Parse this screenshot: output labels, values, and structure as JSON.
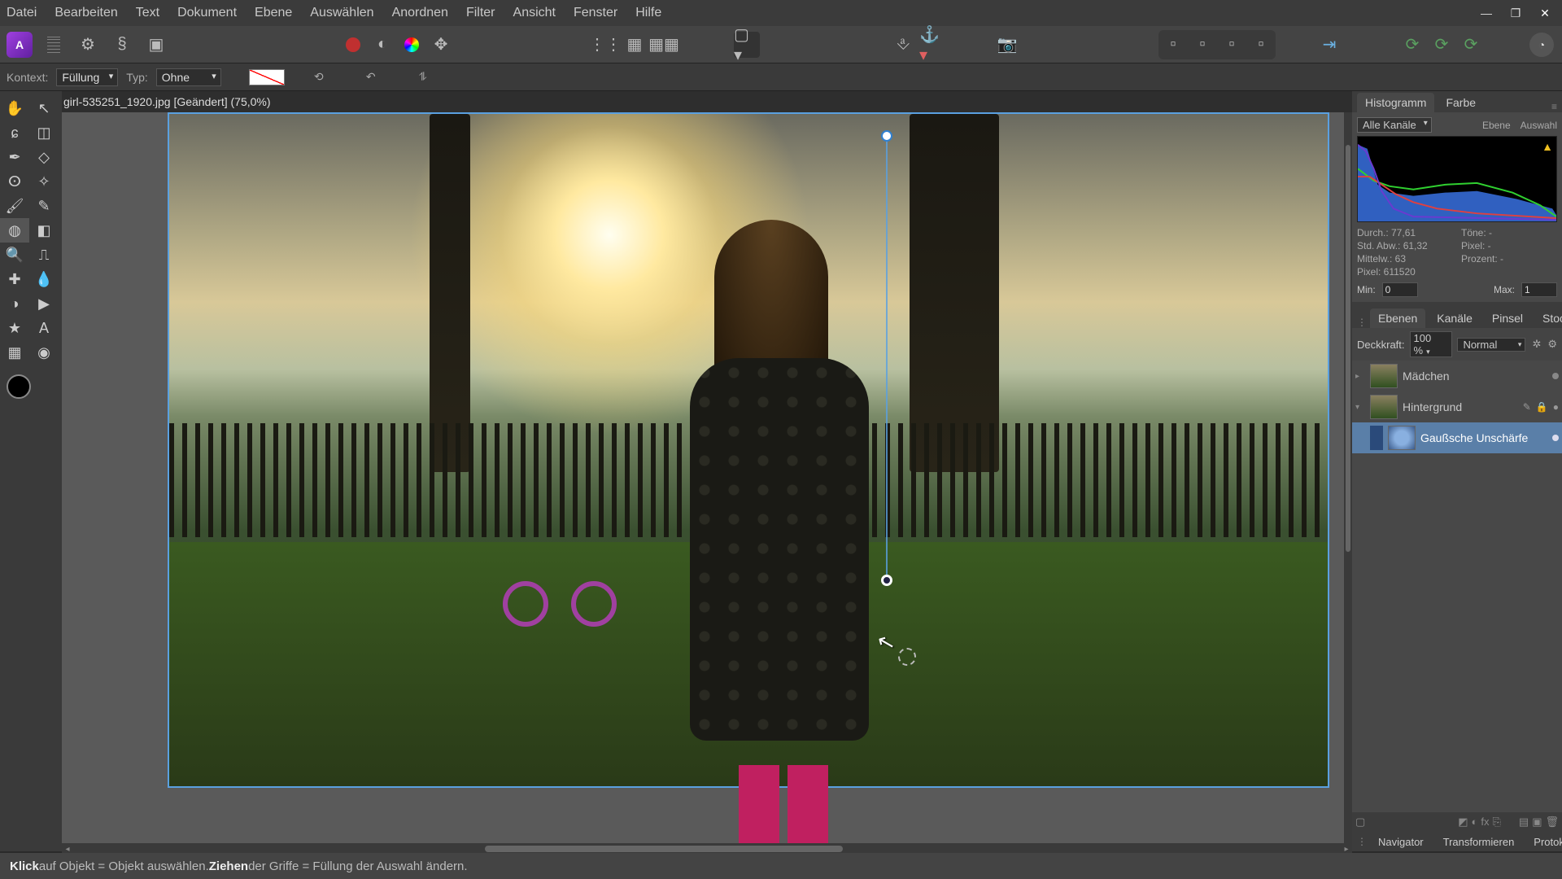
{
  "menu": {
    "datei": "Datei",
    "bearbeiten": "Bearbeiten",
    "text": "Text",
    "dokument": "Dokument",
    "ebene": "Ebene",
    "auswaehlen": "Auswählen",
    "anordnen": "Anordnen",
    "filter": "Filter",
    "ansicht": "Ansicht",
    "fenster": "Fenster",
    "hilfe": "Hilfe"
  },
  "win": {
    "min": "—",
    "max": "❐",
    "close": "✕"
  },
  "document": {
    "filename": "girl-535251_1920.jpg",
    "state": "[Geändert]",
    "zoom": "(75,0%)"
  },
  "context": {
    "label": "Kontext:",
    "tool": "Füllung",
    "type_label": "Typ:",
    "type_value": "Ohne"
  },
  "statusbar": {
    "klick": "Klick",
    "klick_rest": " auf Objekt = Objekt auswählen. ",
    "ziehen": "Ziehen",
    "ziehen_rest": " der Griffe = Füllung der Auswahl ändern."
  },
  "histogram": {
    "tabs": {
      "histogramm": "Histogramm",
      "farbe": "Farbe"
    },
    "channel": "Alle Kanäle",
    "links": {
      "ebene": "Ebene",
      "auswahl": "Auswahl"
    },
    "stats": {
      "durch": "Durch.: 77,61",
      "std": "Std. Abw.: 61,32",
      "mittelw": "Mittelw.: 63",
      "pixel": "Pixel: 611520",
      "toene": "Töne: -",
      "prozent": "Prozent: -"
    },
    "min_label": "Min:",
    "min_value": "0",
    "max_label": "Max:",
    "max_value": "1"
  },
  "layers": {
    "tabs": {
      "ebenen": "Ebenen",
      "kanaele": "Kanäle",
      "pinsel": "Pinsel",
      "stock": "Stock"
    },
    "opacity_label": "Deckkraft:",
    "opacity_value": "100 %",
    "blend": "Normal",
    "items": [
      {
        "name": "Mädchen"
      },
      {
        "name": "Hintergrund"
      },
      {
        "name": "Gaußsche Unschärfe"
      }
    ]
  },
  "bottom_panel": {
    "navigator": "Navigator",
    "transformieren": "Transformieren",
    "protokoll": "Protokoll"
  }
}
